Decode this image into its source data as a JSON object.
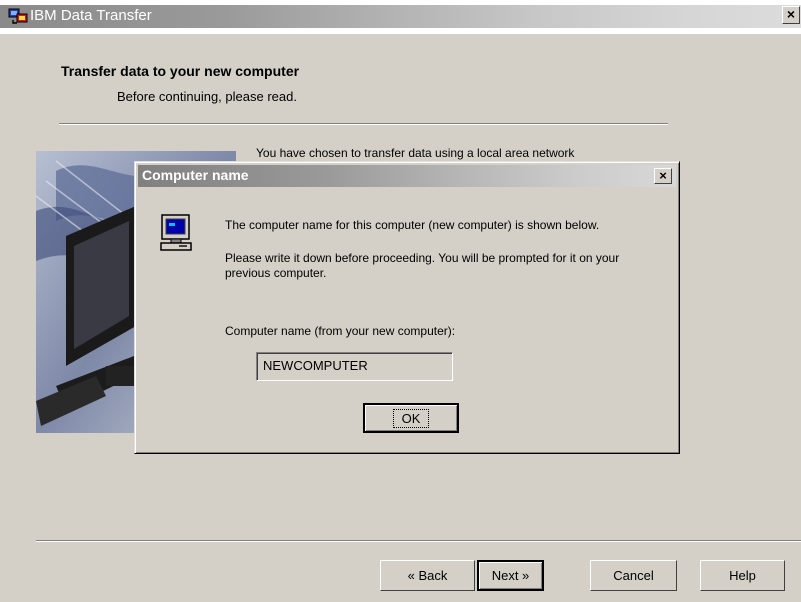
{
  "window": {
    "title": "IBM Data Transfer",
    "close_glyph": "×",
    "icon": "ibm-data-transfer-icon"
  },
  "header": {
    "title": "Transfer data to your new computer",
    "subtitle": "Before continuing, please read."
  },
  "background_text": "You have chosen to transfer data using a local area network",
  "buttons": {
    "back": "« Back",
    "next": "Next »",
    "cancel": "Cancel",
    "help": "Help"
  },
  "dialog": {
    "title": "Computer name",
    "close_glyph": "×",
    "icon": "computer-icon",
    "line1": "The computer name for this computer (new computer) is shown below.",
    "line2": "Please write it down before proceeding.  You will be prompted for it on your previous computer.",
    "field_label": "Computer name (from your new computer):",
    "computer_name": "NEWCOMPUTER",
    "ok_label": "OK"
  }
}
